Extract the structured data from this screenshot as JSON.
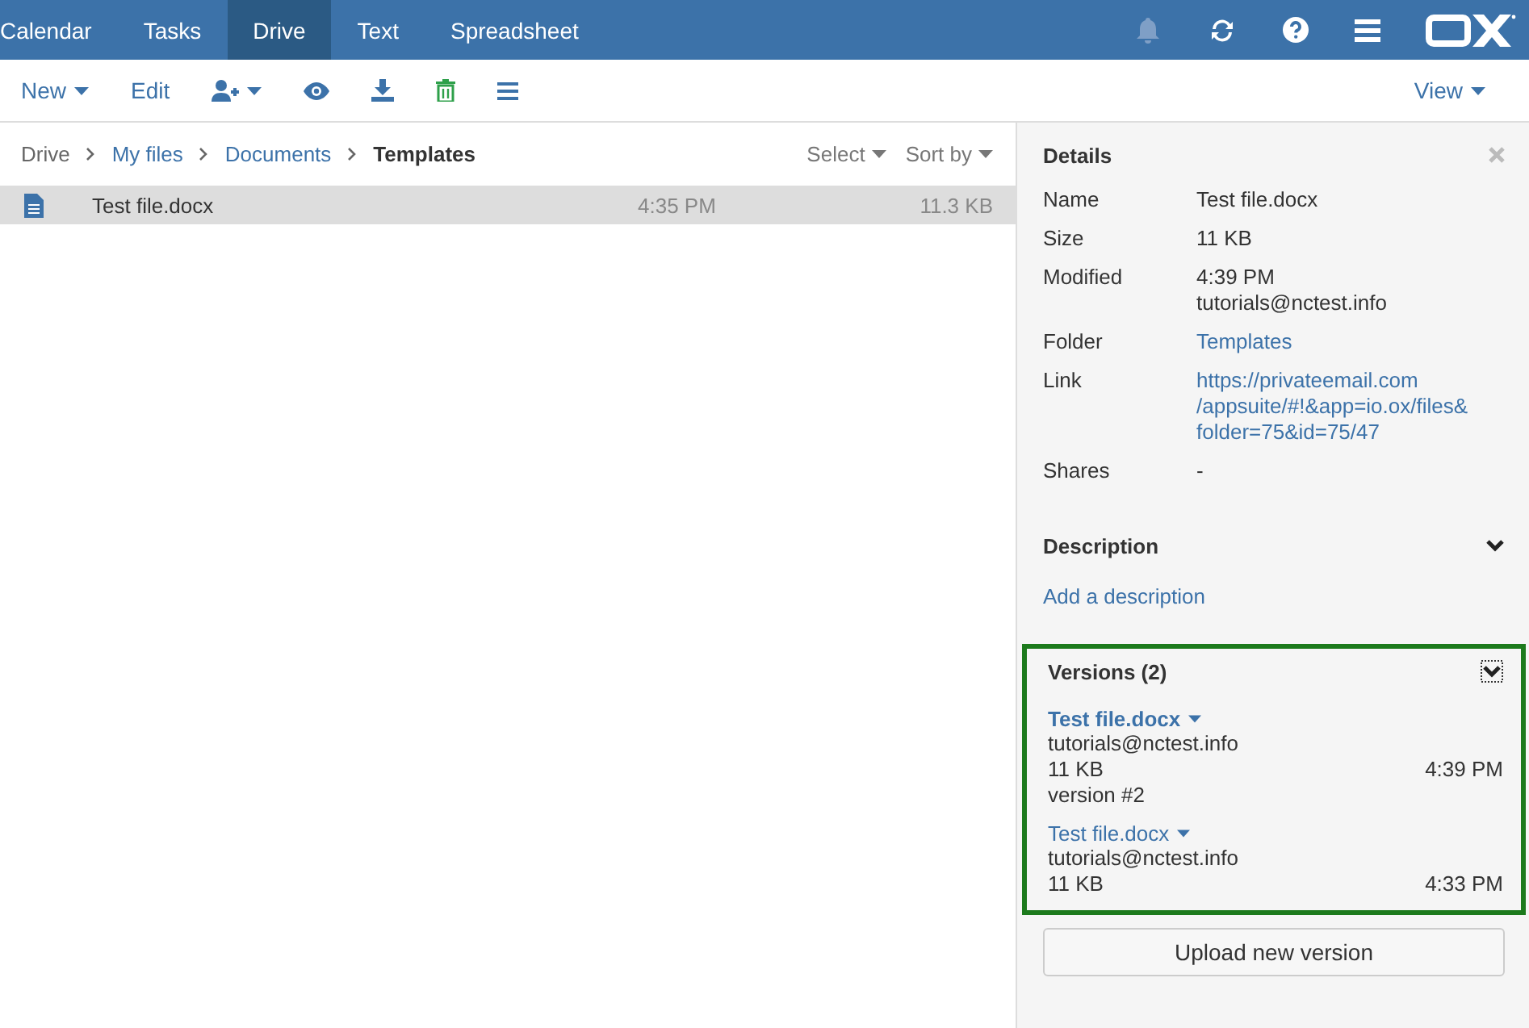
{
  "top_tabs": [
    {
      "label": "Calendar",
      "selected": false
    },
    {
      "label": "Tasks",
      "selected": false
    },
    {
      "label": "Drive",
      "selected": true
    },
    {
      "label": "Text",
      "selected": false
    },
    {
      "label": "Spreadsheet",
      "selected": false
    }
  ],
  "top_icons": [
    {
      "kind": "bell"
    },
    {
      "kind": "refresh"
    },
    {
      "kind": "help"
    },
    {
      "kind": "menu"
    },
    {
      "kind": "logo"
    }
  ],
  "toolbar": [
    {
      "kind": "text",
      "label": "New",
      "caret": true
    },
    {
      "kind": "text",
      "label": "Edit",
      "caret": false
    },
    {
      "kind": "share",
      "caret": true
    },
    {
      "kind": "view",
      "caret": false
    },
    {
      "kind": "download",
      "caret": false
    },
    {
      "kind": "delete",
      "caret": false
    },
    {
      "kind": "more",
      "caret": false
    }
  ],
  "view_menu": {
    "label": "View"
  },
  "breadcrumb": [
    "Drive",
    "My files",
    "Documents",
    "Templates"
  ],
  "list_actions": [
    "Select",
    "Sort by"
  ],
  "files": [
    {
      "name": "Test file.docx",
      "time": "4:35 PM",
      "size": "11.3 KB",
      "selected": true
    }
  ],
  "details": {
    "title": "Details",
    "rows": [
      {
        "label": "Name",
        "kind": "text",
        "lines": [
          "Test file.docx"
        ]
      },
      {
        "label": "Size",
        "kind": "text",
        "lines": [
          "11 KB"
        ]
      },
      {
        "label": "Modified",
        "kind": "text",
        "lines": [
          "4:39 PM",
          "tutorials@nctest.info"
        ]
      },
      {
        "label": "Folder",
        "kind": "link",
        "lines": [
          "Templates"
        ]
      },
      {
        "label": "Link",
        "kind": "link",
        "lines": [
          "https://privateemail.com",
          "/appsuite/#!&app=io.ox/files&",
          "folder=75&id=75/47"
        ]
      },
      {
        "label": "Shares",
        "kind": "text",
        "lines": [
          "-"
        ]
      }
    ],
    "description": {
      "title": "Description",
      "add_link": "Add a description"
    },
    "versions": {
      "title": "Versions (2)",
      "highlighted": true,
      "items": [
        {
          "name": "Test file.docx",
          "author": "tutorials@nctest.info",
          "size": "11 KB",
          "time": "4:39 PM",
          "note": "version #2",
          "current": true
        },
        {
          "name": "Test file.docx",
          "author": "tutorials@nctest.info",
          "size": "11 KB",
          "time": "4:33 PM",
          "current": false
        }
      ]
    },
    "upload_button": "Upload new version"
  }
}
